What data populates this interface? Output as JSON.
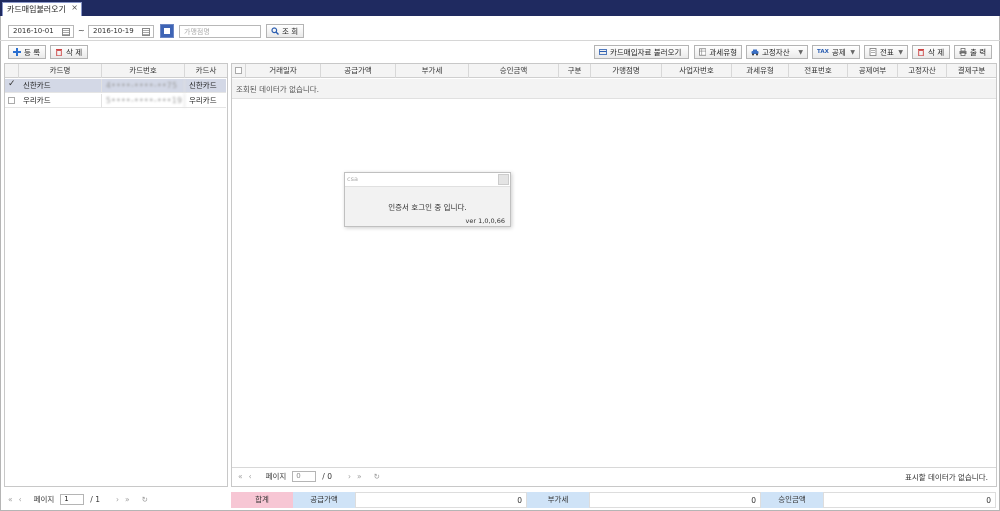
{
  "tab": {
    "title": "카드매입불러오기",
    "close": "×"
  },
  "filters": {
    "date_from": "2016-10-01",
    "range_sep": "~",
    "date_to": "2016-10-19",
    "store_placeholder": "가맹점명",
    "search_label": "조 회"
  },
  "left_toolbar": {
    "add_label": "등 록",
    "delete_label": "삭 제"
  },
  "right_toolbar": {
    "load_label": "카드매입자료 불러오기",
    "tax_type_label": "과세유형",
    "fixed_asset_label": "고정자산",
    "deduction_label": "공제",
    "tax_prefix": "TAX",
    "voucher_label": "전표",
    "delete_label": "삭 제",
    "print_label": "출 력"
  },
  "card_table": {
    "headers": [
      "카드명",
      "카드번호",
      "카드사"
    ],
    "rows": [
      {
        "name": "신한카드",
        "number": "4••••-••••-••75",
        "company": "신한카드",
        "checked": true
      },
      {
        "name": "우리카드",
        "number": "5••••-••••-•••19",
        "company": "우리카드",
        "checked": false
      }
    ]
  },
  "main_table": {
    "headers": [
      "거래일자",
      "공급가액",
      "부가세",
      "승인금액",
      "구분",
      "가맹점명",
      "사업자번호",
      "과세유형",
      "전표번호",
      "공제여부",
      "고정자산",
      "결제구분"
    ],
    "empty_message": "조회된 데이터가 없습니다."
  },
  "left_pager": {
    "page_label": "페이지",
    "page_value": "1",
    "total": "/ 1"
  },
  "main_pager": {
    "page_label": "페이지",
    "page_value": "0",
    "total": "/ 0",
    "status": "표시할 데이터가 없습니다."
  },
  "summary": {
    "total_label": "합계",
    "supply_label": "공급가액",
    "supply_value": "0",
    "vat_label": "부가세",
    "vat_value": "0",
    "approved_label": "승인금액",
    "approved_value": "0"
  },
  "dialog": {
    "title": "csa",
    "message": "인증서 호그인 중 입니다.",
    "version": "ver 1,0,0,66"
  },
  "colors": {
    "tabbar": "#1f2a60",
    "selected_row": "#d3d8e6",
    "total_bg": "#f7c6d4",
    "label_bg": "#cfe3f7"
  }
}
